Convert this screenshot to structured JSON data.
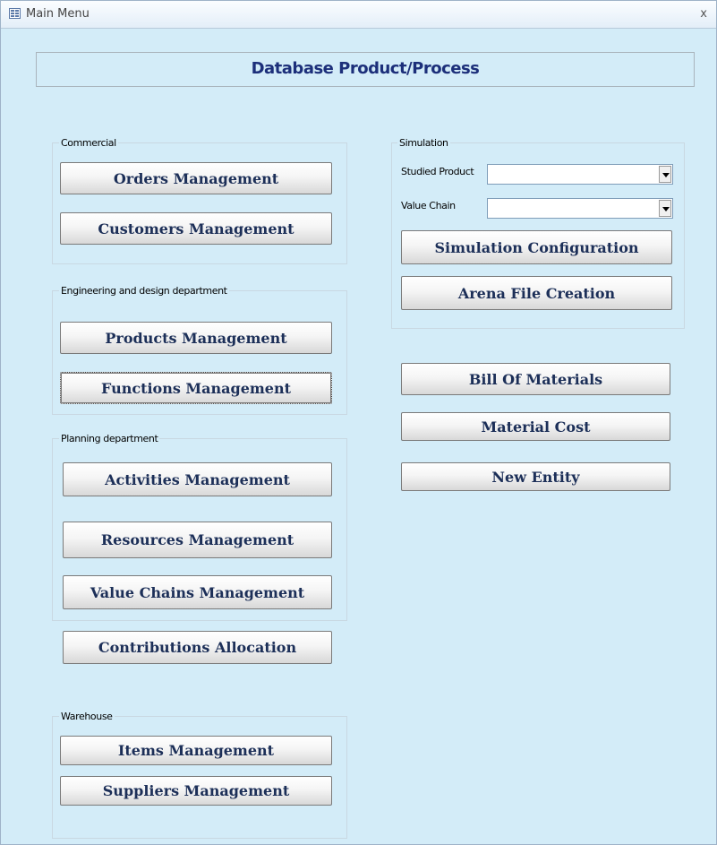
{
  "window": {
    "title": "Main Menu",
    "close_label": "x"
  },
  "header": {
    "title": "Database Product/Process"
  },
  "groups": {
    "commercial": {
      "label": "Commercial",
      "buttons": [
        "Orders Management",
        "Customers Management"
      ]
    },
    "engineering": {
      "label": "Engineering and design department",
      "buttons": [
        "Products Management",
        "Functions Management"
      ]
    },
    "planning": {
      "label": "Planning department",
      "buttons": [
        "Activities Management",
        "Resources Management",
        "Value Chains Management"
      ]
    },
    "warehouse": {
      "label": "Warehouse",
      "buttons": [
        "Items Management",
        "Suppliers Management"
      ]
    },
    "simulation": {
      "label": "Simulation",
      "studied_product_label": "Studied Product",
      "studied_product_value": "",
      "value_chain_label": "Value Chain",
      "value_chain_value": "",
      "buttons": [
        "Simulation Configuration",
        "Arena File Creation"
      ]
    }
  },
  "standalone_buttons": {
    "contributions": "Contributions Allocation",
    "bill_of_materials": "Bill Of Materials",
    "material_cost": "Material Cost",
    "new_entity": "New Entity"
  },
  "colors": {
    "background": "#d3ecf8",
    "header_text": "#1c2f7a",
    "button_text": "#1c2f58"
  }
}
